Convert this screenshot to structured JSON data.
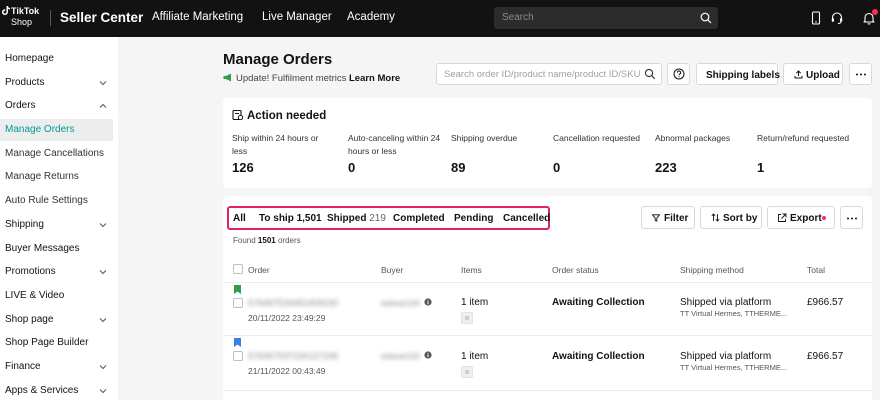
{
  "topbar": {
    "logo_line1": "TikTok",
    "logo_line2": "Shop",
    "app_title": "Seller Center",
    "nav": [
      "Affiliate Marketing",
      "Live Manager",
      "Academy"
    ],
    "search_placeholder": "Search",
    "icons": [
      "search-icon",
      "phone-icon",
      "headset-icon",
      "bell-icon"
    ]
  },
  "sidebar": {
    "items": [
      {
        "label": "Homepage",
        "expandable": false,
        "state": "none"
      },
      {
        "label": "Products",
        "expandable": true,
        "state": "collapsed"
      },
      {
        "label": "Orders",
        "expandable": true,
        "state": "expanded"
      },
      {
        "label": "Manage Orders",
        "expandable": false,
        "state": "active"
      },
      {
        "label": "Manage Cancellations",
        "expandable": false,
        "state": "sub"
      },
      {
        "label": "Manage Returns",
        "expandable": false,
        "state": "sub"
      },
      {
        "label": "Auto Rule Settings",
        "expandable": false,
        "state": "sub"
      },
      {
        "label": "Shipping",
        "expandable": true,
        "state": "collapsed"
      },
      {
        "label": "Buyer Messages",
        "expandable": false,
        "state": "none"
      },
      {
        "label": "Promotions",
        "expandable": true,
        "state": "collapsed"
      },
      {
        "label": "LIVE & Video",
        "expandable": false,
        "state": "none"
      },
      {
        "label": "Shop page",
        "expandable": true,
        "state": "collapsed"
      },
      {
        "label": "Shop Page Builder",
        "expandable": false,
        "state": "none"
      },
      {
        "label": "Finance",
        "expandable": true,
        "state": "collapsed"
      },
      {
        "label": "Apps & Services",
        "expandable": true,
        "state": "collapsed"
      }
    ]
  },
  "main": {
    "title": "Manage Orders",
    "update_text": "Update! Fulfilment metrics",
    "learn_more": "Learn More",
    "order_search_placeholder": "Search order ID/product name/product ID/SKU ID",
    "buttons": {
      "shipping_labels": "Shipping labels",
      "upload": "Upload",
      "filter": "Filter",
      "sort_by": "Sort by",
      "export": "Export"
    }
  },
  "action_needed": {
    "title": "Action needed",
    "stats": [
      {
        "label": "Ship within 24 hours or less",
        "value": "126"
      },
      {
        "label": "Auto-canceling within 24 hours or less",
        "value": "0"
      },
      {
        "label": "Shipping overdue",
        "value": "89"
      },
      {
        "label": "Cancellation requested",
        "value": "0"
      },
      {
        "label": "Abnormal packages",
        "value": "223"
      },
      {
        "label": "Return/refund requested",
        "value": "1"
      }
    ]
  },
  "orders": {
    "tabs": [
      {
        "label": "All",
        "count": ""
      },
      {
        "label": "To ship 1,501",
        "count": ""
      },
      {
        "label": "Shipped",
        "count": "219"
      },
      {
        "label": "Completed",
        "count": ""
      },
      {
        "label": "Pending",
        "count": ""
      },
      {
        "label": "Cancelled",
        "count": ""
      }
    ],
    "found_prefix": "Found",
    "found_count": "1501",
    "found_suffix": "orders",
    "columns": [
      "Order",
      "Buyer",
      "Items",
      "Order status",
      "Shipping method",
      "Total"
    ],
    "rows": [
      {
        "flag_color": "#2e9e4a",
        "order_id": "576467534452409230",
        "date": "20/11/2022 23:49:29",
        "buyer": "edwuk100",
        "items": "1 item",
        "status": "Awaiting Collection",
        "shipping": "Shipped via platform",
        "carrier": "TT Virtual Hermes, TTHERME...",
        "total": "£966.57"
      },
      {
        "flag_color": "#3d7ee6",
        "order_id": "576467537226127246",
        "date": "21/11/2022 00:43:49",
        "buyer": "edwuk100",
        "items": "1 item",
        "status": "Awaiting Collection",
        "shipping": "Shipped via platform",
        "carrier": "TT Virtual Hermes, TTHERME...",
        "total": "£966.57"
      }
    ]
  },
  "colors": {
    "topbar_bg": "#121212",
    "active_text": "#009995",
    "tab_highlight": "#e0245e",
    "notification": "#fe2c55"
  }
}
